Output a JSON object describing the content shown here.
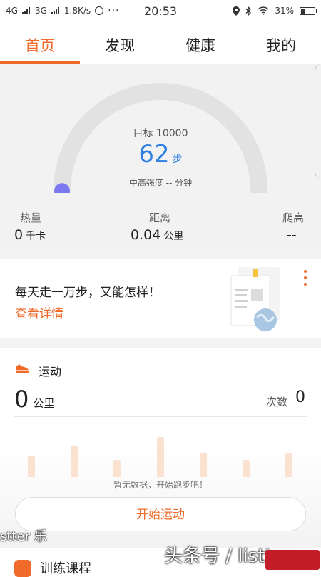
{
  "status_bar": {
    "network1": "4G",
    "network2": "3G",
    "speed": "1.8K/s",
    "time": "20:53",
    "battery": "31%",
    "battery_level": 0.31
  },
  "tabs": [
    {
      "label": "首页",
      "active": true
    },
    {
      "label": "发现",
      "active": false
    },
    {
      "label": "健康",
      "active": false
    },
    {
      "label": "我的",
      "active": false
    }
  ],
  "summary": {
    "goal": "目标 10000",
    "steps": "62",
    "steps_unit": "步",
    "intensity": "中高强度 -- 分钟",
    "progress_fraction": 0.0062,
    "stats": [
      {
        "label": "热量",
        "value": "0",
        "unit": "千卡"
      },
      {
        "label": "距离",
        "value": "0.04",
        "unit": "公里"
      },
      {
        "label": "爬高",
        "value": "--",
        "unit": ""
      }
    ]
  },
  "article": {
    "title": "每天走一万步，又能怎样！",
    "link": "查看详情"
  },
  "sport": {
    "title": "运动",
    "distance": "0",
    "distance_unit": "公里",
    "count_label": "次数",
    "count": "0",
    "no_data": "暂无数据，开始跑步吧！",
    "start_button": "开始运动"
  },
  "training": {
    "title": "训练课程"
  },
  "watermarks": {
    "left": "stter 乐",
    "right": "头条号 / listter"
  },
  "colors": {
    "accent": "#f06a2a",
    "steps_blue": "#2f7fe0",
    "gauge_dot": "#7b78f0"
  }
}
